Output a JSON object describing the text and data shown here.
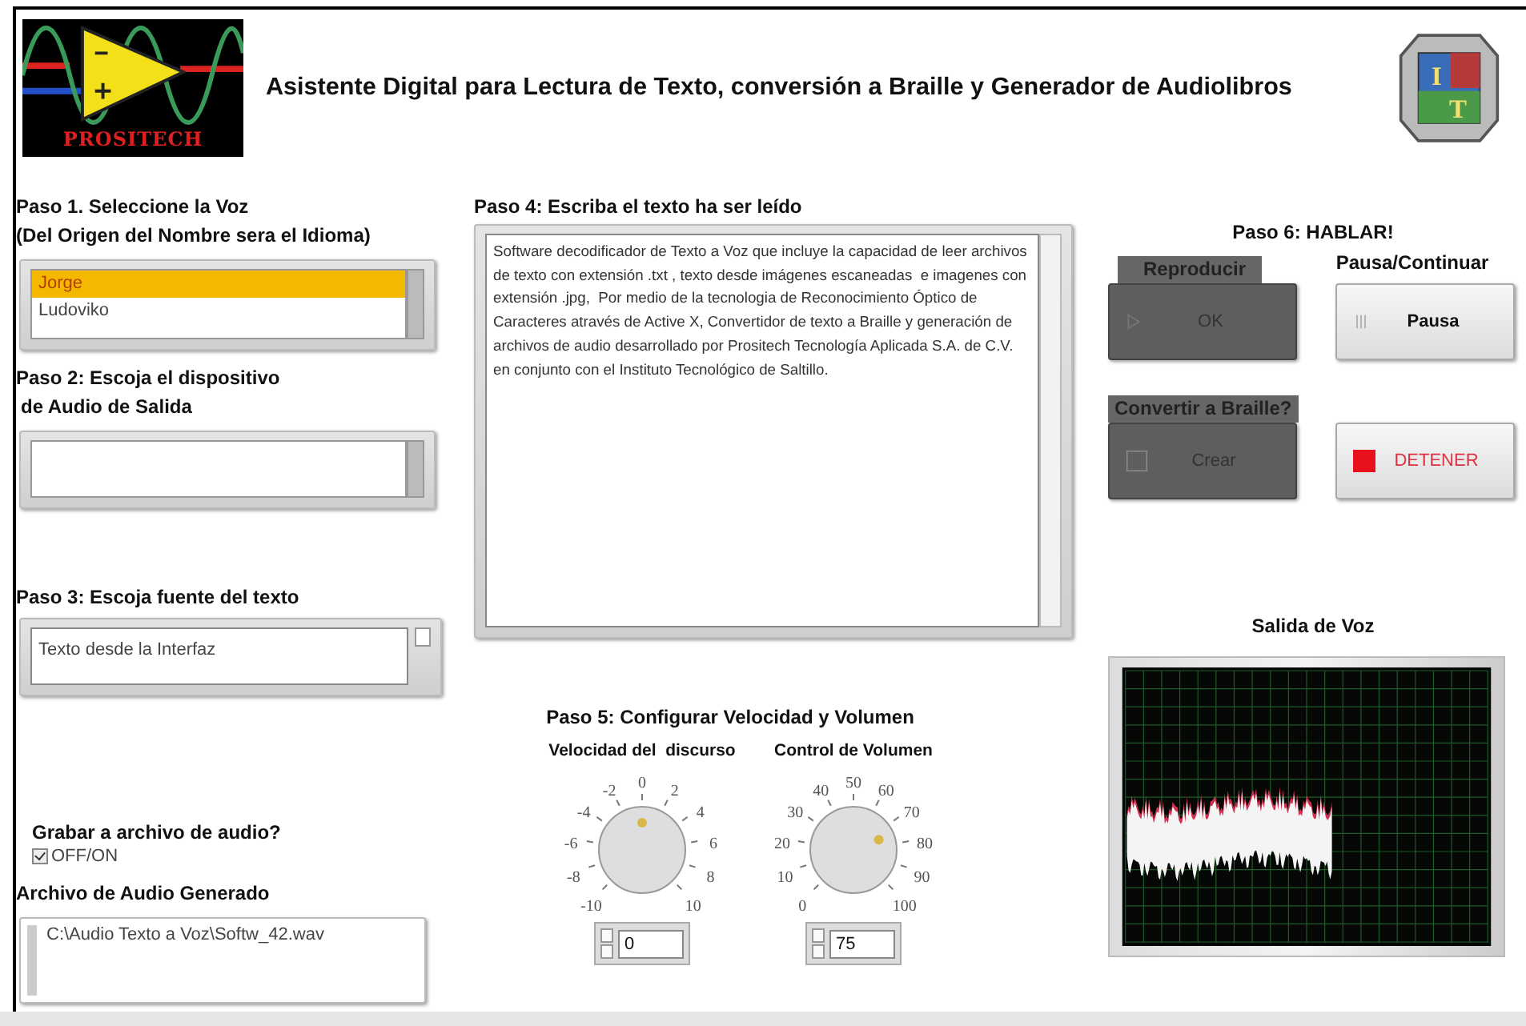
{
  "header": {
    "logo_text": "PROSITECH",
    "title": "Asistente Digital para Lectura de Texto, conversión a Braille y Generador de Audiolibros",
    "emblem_letters": [
      "I",
      "T"
    ]
  },
  "voice": {
    "label_lines": [
      "Paso 1. Seleccione la Voz",
      "(Del Origen del Nombre sera el Idioma)"
    ],
    "items": [
      {
        "label": "Jorge",
        "selected": true
      },
      {
        "label": "Ludoviko",
        "selected": false
      }
    ]
  },
  "device": {
    "label_lines": [
      "Paso 2: Escoja el dispositivo",
      "de Audio de Salida"
    ]
  },
  "source": {
    "label": "Paso 3: Escoja fuente del texto",
    "value": "Texto desde la Interfaz"
  },
  "record": {
    "label": "Grabar a archivo de audio?",
    "option": "OFF/ON",
    "checked": true
  },
  "audio_file": {
    "label": "Archivo de Audio Generado",
    "value": "C:\\Audio Texto a Voz\\Softw_42.wav"
  },
  "text_input": {
    "label": "Paso 4: Escriba el texto ha ser leído",
    "value": "Software decodificador de Texto a Voz que incluye la capacidad de leer archivos de texto con extensión .txt , texto desde imágenes escaneadas  e imagenes con extensión .jpg,  Por medio de la tecnologia de Reconocimiento Óptico de Caracteres através de Active X, Convertidor de texto a Braille y generación de archivos de audio desarrollado por Prositech Tecnología Aplicada S.A. de C.V. en conjunto con el Instituto Tecnológico de Saltillo."
  },
  "settings": {
    "title": "Paso 5: Configurar Velocidad y Volumen",
    "knobs": [
      {
        "label": "Velocidad del  discurso",
        "ticks": [
          "-10",
          "-8",
          "-6",
          "-4",
          "-2",
          "0",
          "2",
          "4",
          "6",
          "8",
          "10"
        ],
        "value": "0"
      },
      {
        "label": "Control de Volumen",
        "ticks": [
          "0",
          "10",
          "20",
          "30",
          "40",
          "50",
          "60",
          "70",
          "80",
          "90",
          "100"
        ],
        "value": "75"
      }
    ]
  },
  "speak": {
    "title": "Paso 6: HABLAR!",
    "controls": [
      {
        "label": "Reproducir",
        "button": "OK",
        "kind": "play",
        "disabled": true
      },
      {
        "label": "Pausa/Continuar",
        "button": "Pausa",
        "kind": "pause",
        "disabled": false
      },
      {
        "label": "Convertir a Braille?",
        "button": "Crear",
        "kind": "braille",
        "disabled": true
      },
      {
        "button": "DETENER",
        "kind": "stop",
        "disabled": false
      }
    ]
  },
  "output": {
    "title": "Salida de Voz"
  }
}
